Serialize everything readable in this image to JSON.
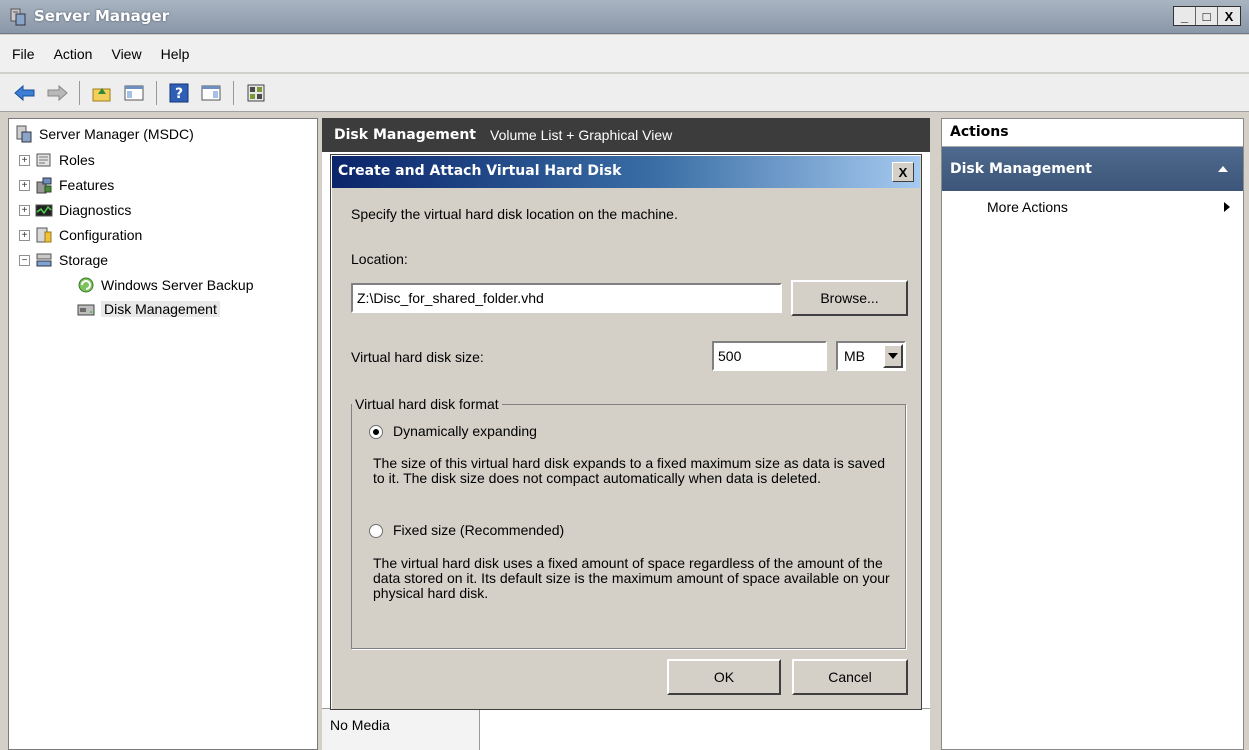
{
  "window": {
    "title": "Server Manager",
    "controls": [
      "_",
      "□",
      "X"
    ]
  },
  "menu": [
    "File",
    "Action",
    "View",
    "Help"
  ],
  "tree": {
    "root": "Server Manager (MSDC)",
    "roles": "Roles",
    "features": "Features",
    "diagnostics": "Diagnostics",
    "configuration": "Configuration",
    "storage": "Storage",
    "wsb": "Windows Server Backup",
    "disk_mgmt": "Disk Management",
    "expand_plus": "+",
    "expand_minus": "−"
  },
  "center": {
    "title": "Disk Management",
    "subtitle": "Volume List + Graphical View",
    "no_media": "No Media"
  },
  "actions": {
    "title": "Actions",
    "section": "Disk Management",
    "item": "More Actions"
  },
  "dialog": {
    "title": "Create and Attach Virtual Hard Disk",
    "close": "X",
    "intro": "Specify the virtual hard disk location on the machine.",
    "location_label": "Location:",
    "location_value": "Z:\\Disc_for_shared_folder.vhd",
    "browse": "Browse...",
    "size_label": "Virtual hard disk size:",
    "size_value": "500",
    "size_unit": "MB",
    "format_group": "Virtual hard disk format",
    "option_dynamic": "Dynamically expanding",
    "option_dynamic_desc": "The size of this virtual hard disk expands to a fixed maximum size as data is saved to it.  The disk size does not compact automatically when data is deleted.",
    "option_fixed": "Fixed size (Recommended)",
    "option_fixed_desc": "The virtual hard disk uses a fixed amount of space regardless of the amount of the data stored on it.  Its default size is the maximum amount of space available on your physical hard disk.",
    "selected_option": "dynamic",
    "ok": "OK",
    "cancel": "Cancel"
  }
}
